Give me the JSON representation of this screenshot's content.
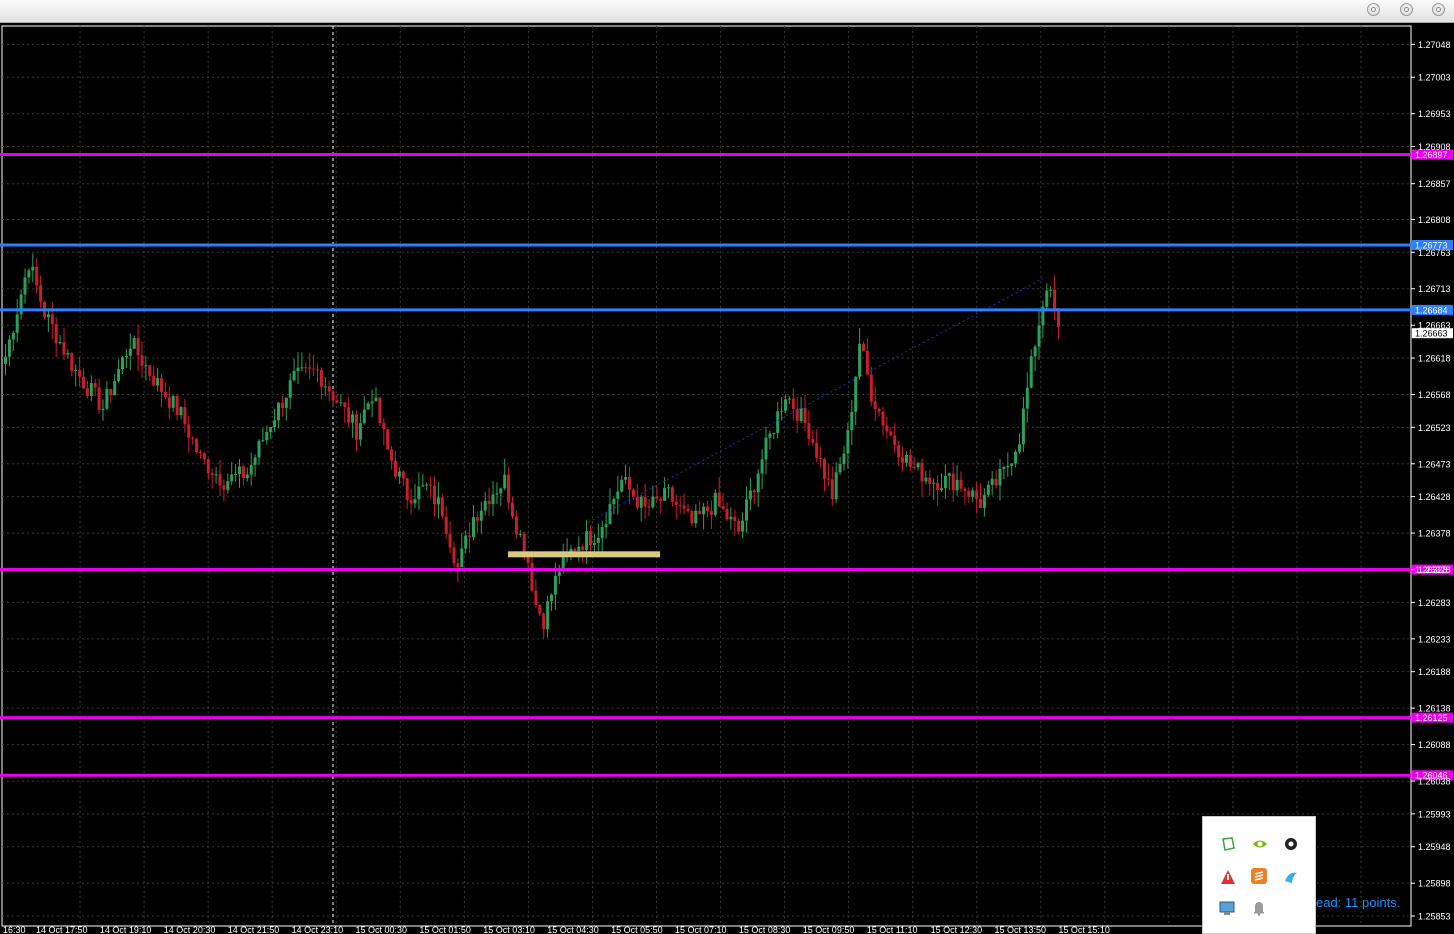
{
  "window": {
    "buttons": [
      "minimize",
      "zoom",
      "close"
    ]
  },
  "chart_data": {
    "type": "candlestick",
    "ylim": [
      1.25853,
      1.27065
    ],
    "grid": true,
    "colors": {
      "background": "#000000",
      "grid": "#3a3a3a",
      "bull": "#2ca05a",
      "bear": "#c81e2a",
      "axis_text": "#ffffff",
      "magenta_level": "#e800e8",
      "blue_level": "#2e7fff",
      "zone": "#d8c880"
    },
    "price_ticks": [
      "1.27048",
      "1.27003",
      "1.26953",
      "1.26908",
      "1.26857",
      "1.26808",
      "1.26763",
      "1.26713",
      "1.26663",
      "1.26618",
      "1.26568",
      "1.26523",
      "1.26473",
      "1.26428",
      "1.26378",
      "1.26328",
      "1.26283",
      "1.26233",
      "1.26188",
      "1.26138",
      "1.26088",
      "1.26038",
      "1.25993",
      "1.25948",
      "1.25898",
      "1.25853"
    ],
    "time_ticks": [
      "16:30",
      "14 Oct 17:50",
      "14 Oct 19:10",
      "14 Oct 20:30",
      "14 Oct 21:50",
      "14 Oct 23:10",
      "15 Oct 00:30",
      "15 Oct 01:50",
      "15 Oct 03:10",
      "15 Oct 04:30",
      "15 Oct 05:50",
      "15 Oct 07:10",
      "15 Oct 08:30",
      "15 Oct 09:50",
      "15 Oct 11:10",
      "15 Oct 12:30",
      "15 Oct 13:50",
      "15 Oct 15:10"
    ],
    "levels": [
      {
        "price": 1.26897,
        "label": "1.26897",
        "color": "#e800e8"
      },
      {
        "price": 1.26773,
        "label": "1.26773",
        "color": "#2e7fff"
      },
      {
        "price": 1.26684,
        "label": "1.26684",
        "color": "#2e7fff"
      },
      {
        "price": 1.26328,
        "label": "1.26328",
        "color": "#e800e8"
      },
      {
        "price": 1.26125,
        "label": "1.26125",
        "color": "#e800e8"
      },
      {
        "price": 1.26046,
        "label": "1.26046",
        "color": "#e800e8"
      }
    ],
    "current_price": {
      "label": "1.26663"
    },
    "anchors": [
      [
        0,
        1.2662
      ],
      [
        6,
        1.2675
      ],
      [
        10,
        1.2668
      ],
      [
        18,
        1.266
      ],
      [
        25,
        1.2655
      ],
      [
        32,
        1.2664
      ],
      [
        38,
        1.2659
      ],
      [
        45,
        1.2654
      ],
      [
        50,
        1.2648
      ],
      [
        56,
        1.2645
      ],
      [
        62,
        1.2646
      ],
      [
        68,
        1.2653
      ],
      [
        74,
        1.2659
      ],
      [
        80,
        1.266
      ],
      [
        85,
        1.2656
      ],
      [
        90,
        1.2652
      ],
      [
        94,
        1.2657
      ],
      [
        98,
        1.2649
      ],
      [
        103,
        1.2643
      ],
      [
        108,
        1.2644
      ],
      [
        112,
        1.2641
      ],
      [
        116,
        1.2633
      ],
      [
        120,
        1.264
      ],
      [
        124,
        1.2643
      ],
      [
        128,
        1.2645
      ],
      [
        131,
        1.2639
      ],
      [
        134,
        1.2634
      ],
      [
        136,
        1.2628
      ],
      [
        138,
        1.2626
      ],
      [
        142,
        1.2633
      ],
      [
        146,
        1.2636
      ],
      [
        152,
        1.2638
      ],
      [
        158,
        1.2645
      ],
      [
        164,
        1.2641
      ],
      [
        170,
        1.2643
      ],
      [
        176,
        1.2639
      ],
      [
        182,
        1.2642
      ],
      [
        188,
        1.2638
      ],
      [
        194,
        1.2648
      ],
      [
        200,
        1.2657
      ],
      [
        206,
        1.2652
      ],
      [
        212,
        1.2643
      ],
      [
        216,
        1.2651
      ],
      [
        219,
        1.2664
      ],
      [
        222,
        1.2657
      ],
      [
        226,
        1.2652
      ],
      [
        232,
        1.2647
      ],
      [
        238,
        1.2645
      ],
      [
        244,
        1.2645
      ],
      [
        250,
        1.2642
      ],
      [
        256,
        1.2646
      ],
      [
        260,
        1.2651
      ],
      [
        264,
        1.2664
      ],
      [
        267,
        1.2672
      ],
      [
        270,
        1.2666
      ]
    ]
  },
  "tray": {
    "icons": [
      "shape-icon",
      "nvidia-icon",
      "virus-scanner-icon",
      "warning-icon",
      "sublime-icon",
      "bird-icon",
      "computer-icon",
      "bell-icon"
    ]
  },
  "spread": {
    "text": "ead: 11 points."
  }
}
